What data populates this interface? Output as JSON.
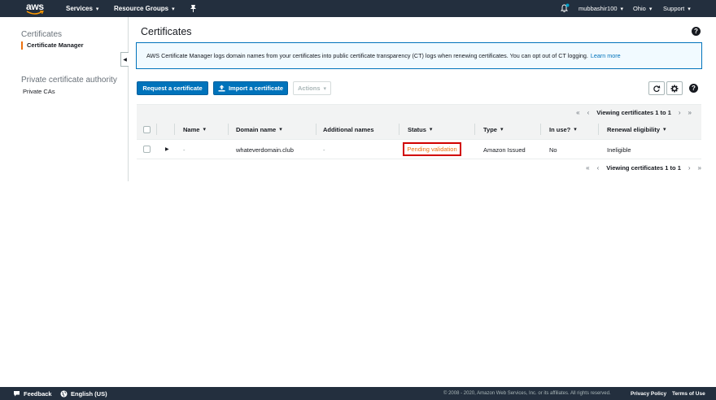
{
  "topnav": {
    "logo": "aws",
    "services": "Services",
    "resource_groups": "Resource Groups",
    "pin_icon": "pin-icon",
    "bell_icon": "bell-icon",
    "user": "mubbashir100",
    "region": "Ohio",
    "support": "Support",
    "caret": "▾",
    "bell_dot_color": "#00a1c9"
  },
  "sidebar": {
    "section1_title": "Certificates",
    "section1_active": "Certificate Manager",
    "section2_title": "Private certificate authority",
    "section2_link": "Private CAs",
    "accent_color": "#ec7211"
  },
  "main": {
    "title": "Certificates",
    "info_text": "AWS Certificate Manager logs domain names from your certificates into public certificate transparency (CT) logs when renewing certificates. You can opt out of CT logging.",
    "info_link": "Learn more",
    "buttons": {
      "request": "Request a certificate",
      "import": "Import a certificate",
      "actions": "Actions"
    },
    "pager_text": "Viewing certificates 1 to 1",
    "columns": [
      "Name",
      "Domain name",
      "Additional names",
      "Status",
      "Type",
      "In use?",
      "Renewal eligibility"
    ],
    "rows": [
      {
        "name": "-",
        "domain": "whateverdomain.club",
        "additional": "-",
        "status": "Pending validation",
        "type": "Amazon Issued",
        "in_use": "No",
        "renewal": "Ineligible"
      }
    ],
    "primary_color": "#0073bb",
    "status_color": "#ec7211",
    "highlight_color": "#d10000"
  },
  "footer": {
    "feedback": "Feedback",
    "language": "English (US)",
    "copyright": "© 2008 - 2020, Amazon Web Services, Inc. or its affiliates. All rights reserved.",
    "privacy": "Privacy Policy",
    "terms": "Terms of Use"
  }
}
